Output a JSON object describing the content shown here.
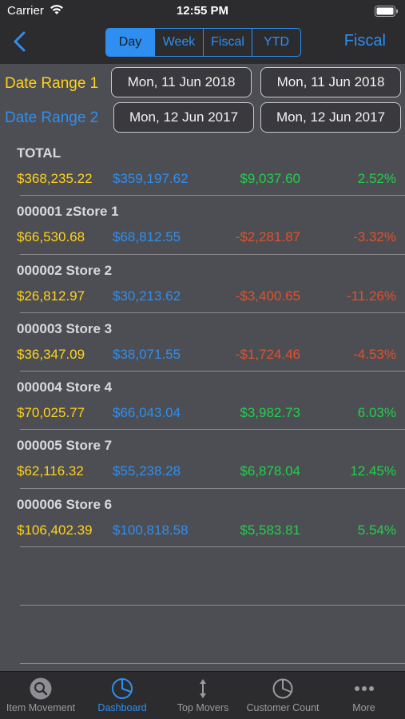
{
  "status": {
    "carrier": "Carrier",
    "time": "12:55 PM"
  },
  "nav": {
    "segments": [
      "Day",
      "Week",
      "Fiscal",
      "YTD"
    ],
    "active_segment": "Day",
    "right_label": "Fiscal"
  },
  "date_ranges": [
    {
      "label": "Date Range 1",
      "start": "Mon, 11 Jun 2018",
      "end": "Mon, 11 Jun 2018",
      "color": "#ffd21a"
    },
    {
      "label": "Date Range 2",
      "start": "Mon, 12 Jun 2017",
      "end": "Mon, 12 Jun 2017",
      "color": "#2e8ff0"
    }
  ],
  "rows": [
    {
      "name": "TOTAL",
      "v1": "$368,235.22",
      "v2": "$359,197.62",
      "diff": "$9,037.60",
      "pct": "2.52%",
      "trend": "pos"
    },
    {
      "name": "000001 zStore 1",
      "v1": "$66,530.68",
      "v2": "$68,812.55",
      "diff": "-$2,281.87",
      "pct": "-3.32%",
      "trend": "neg"
    },
    {
      "name": "000002 Store 2",
      "v1": "$26,812.97",
      "v2": "$30,213.62",
      "diff": "-$3,400.65",
      "pct": "-11.26%",
      "trend": "neg"
    },
    {
      "name": "000003 Store 3",
      "v1": "$36,347.09",
      "v2": "$38,071.55",
      "diff": "-$1,724.46",
      "pct": "-4.53%",
      "trend": "neg"
    },
    {
      "name": "000004 Store 4",
      "v1": "$70,025.77",
      "v2": "$66,043.04",
      "diff": "$3,982.73",
      "pct": "6.03%",
      "trend": "pos"
    },
    {
      "name": "000005 Store 7",
      "v1": "$62,116.32",
      "v2": "$55,238.28",
      "diff": "$6,878.04",
      "pct": "12.45%",
      "trend": "pos"
    },
    {
      "name": "000006 Store 6",
      "v1": "$106,402.39",
      "v2": "$100,818.58",
      "diff": "$5,583.81",
      "pct": "5.54%",
      "trend": "pos"
    }
  ],
  "tabs": [
    {
      "label": "Item Movement",
      "icon": "magnifier-icon",
      "active": false
    },
    {
      "label": "Dashboard",
      "icon": "pie-chart-icon",
      "active": true
    },
    {
      "label": "Top Movers",
      "icon": "up-down-arrow-icon",
      "active": false
    },
    {
      "label": "Customer Count",
      "icon": "clock-pie-icon",
      "active": false
    },
    {
      "label": "More",
      "icon": "more-dots-icon",
      "active": false
    }
  ],
  "colors": {
    "accent": "#2e8ff0",
    "range1": "#ffd21a",
    "positive": "#1fd14a",
    "negative": "#e2512b"
  }
}
